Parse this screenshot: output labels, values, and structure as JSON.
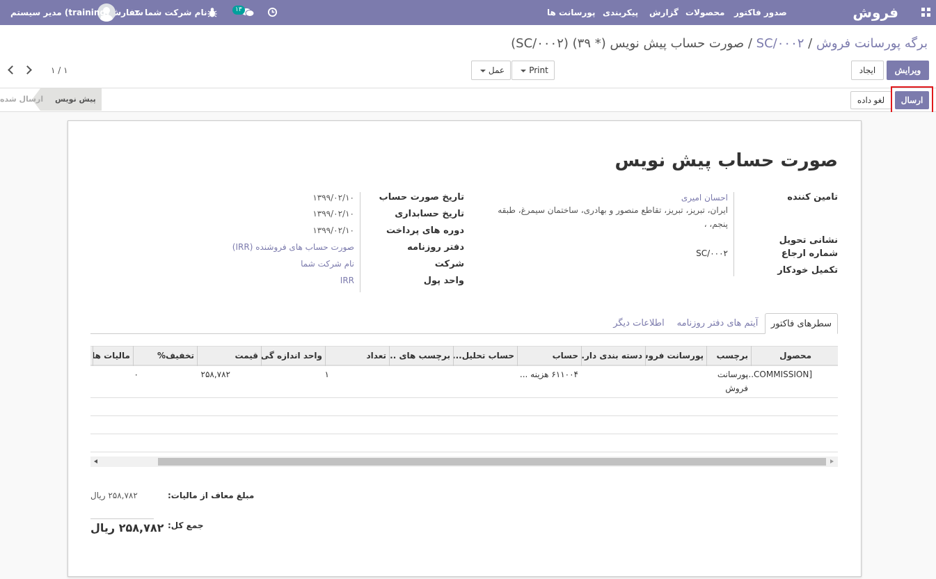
{
  "navbar": {
    "brand": "فروش",
    "menu": [
      "سفارش ها",
      "صدور فاکتور",
      "محصولات",
      "گزارش",
      "پیکربندی",
      "پورسانت ها"
    ],
    "messages_count": "۱۳",
    "company": "نام شرکت شما",
    "user": "مدیر سیستم (training)",
    "color": "#7c7bad"
  },
  "breadcrumb": {
    "root": "برگه پورسانت فروش",
    "ref": "SC/۰۰۰۲",
    "current": "صورت حساب پیش نویس (* ۳۹) (SC/۰۰۰۲)"
  },
  "toolbar": {
    "edit_label": "ویرایش",
    "create_label": "ایجاد",
    "print_label": "Print",
    "action_label": "عمل",
    "pager": "۱ / ۱"
  },
  "statusbar": {
    "send_label": "ارسال",
    "cancel_label": "لغو داده",
    "states": [
      "پیش نویس",
      "ارسال شده"
    ],
    "active_state": "پیش نویس"
  },
  "form": {
    "title": "صورت حساب پیش نویس",
    "right_labels": [
      "تامین کننده",
      "نشانی تحویل",
      "شماره ارجاع",
      "تکمیل خودکار"
    ],
    "vendor_name": "احسان امیری",
    "vendor_address_1": "ایران، تبریز، تبریز، تقاطع منصور و بهادری، ساختمان سیمرغ، طبقه",
    "vendor_address_2": "پنجم، ،",
    "reference": "SC/۰۰۰۲",
    "left_labels": [
      "تاریخ صورت حساب",
      "تاریخ حسابداری",
      "دوره های پرداخت",
      "دفتر روزنامه",
      "شرکت",
      "واحد پول"
    ],
    "invoice_date": "۱۳۹۹/۰۲/۱۰",
    "accounting_date": "۱۳۹۹/۰۲/۱۰",
    "payment_terms": "۱۳۹۹/۰۲/۱۰",
    "journal": "صورت حساب های فروشنده (IRR)",
    "company": "نام شرکت شما",
    "currency": "IRR"
  },
  "tabs": [
    "سطرهای فاکتور",
    "آیتم های دفتر روزنامه",
    "اطلاعات دیگر"
  ],
  "table": {
    "headers": [
      "محصول",
      "برچسب",
      "پورسانت فروش",
      "دسته بندی دار...",
      "حساب",
      "حساب تحلیل...",
      "برچسب های ...",
      "تعداد",
      "واحد اندازه گی...",
      "قیمت",
      "تخفیف%",
      "مالیات ها"
    ],
    "row": {
      "product": "[COMMISSION...",
      "label_1": "پورسانت",
      "label_2": "فروش",
      "account": "۶۱۱۰۰۴ هزینه ...",
      "quantity": "۱",
      "price": "۲۵۸,۷۸۲",
      "discount": "۰"
    }
  },
  "totals": {
    "untaxed_label": "مبلغ معاف از مالیات:",
    "untaxed_value": "۲۵۸,۷۸۲ ریال",
    "total_label": "جمع کل:",
    "total_value": "۲۵۸,۷۸۲ ریال"
  }
}
